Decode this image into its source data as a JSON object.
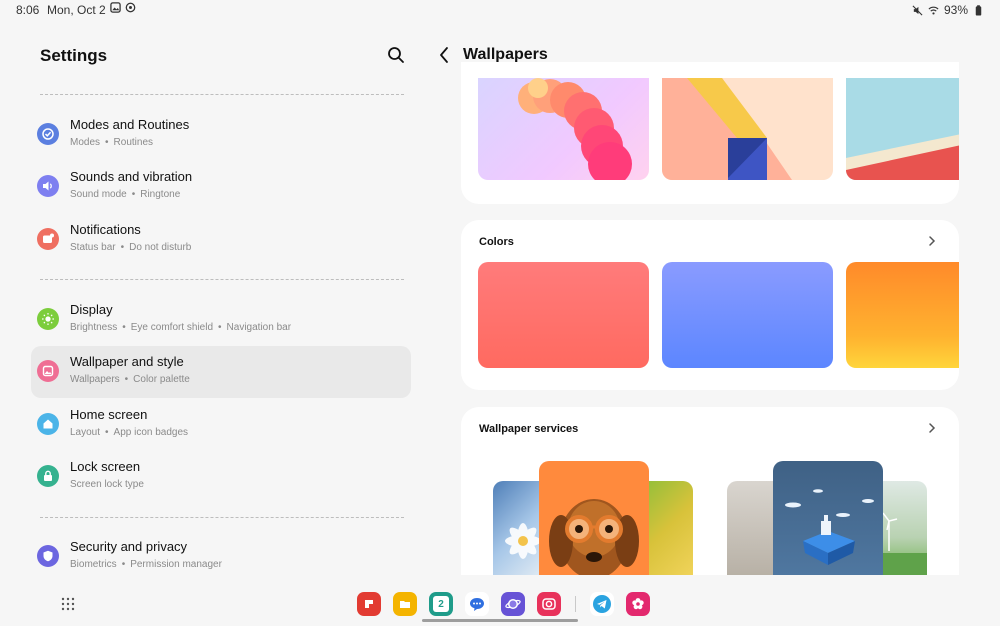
{
  "status": {
    "time": "8:06",
    "date": "Mon, Oct 2",
    "battery": "93%"
  },
  "left": {
    "title": "Settings",
    "items": [
      {
        "title": "Modes and Routines",
        "subs": [
          "Modes",
          "Routines"
        ],
        "color": "#5b7fe0"
      },
      {
        "title": "Sounds and vibration",
        "subs": [
          "Sound mode",
          "Ringtone"
        ],
        "color": "#7e7ff0"
      },
      {
        "title": "Notifications",
        "subs": [
          "Status bar",
          "Do not disturb"
        ],
        "color": "#ef6f61"
      },
      {
        "title": "Display",
        "subs": [
          "Brightness",
          "Eye comfort shield",
          "Navigation bar"
        ],
        "color": "#7ccd3c"
      },
      {
        "title": "Wallpaper and style",
        "subs": [
          "Wallpapers",
          "Color palette"
        ],
        "color": "#ef6e94"
      },
      {
        "title": "Home screen",
        "subs": [
          "Layout",
          "App icon badges"
        ],
        "color": "#4bb4e8"
      },
      {
        "title": "Lock screen",
        "subs": [
          "Screen lock type"
        ],
        "color": "#35b28f"
      },
      {
        "title": "Security and privacy",
        "subs": [
          "Biometrics",
          "Permission manager"
        ],
        "color": "#6c66e0"
      }
    ]
  },
  "right": {
    "title": "Wallpapers",
    "colors_label": "Colors",
    "services_label": "Wallpaper services"
  },
  "dock": {
    "apps": [
      {
        "name": "flipboard",
        "color": "#e23b32"
      },
      {
        "name": "my-files",
        "color": "#f4b400"
      },
      {
        "name": "calendar",
        "color": "#1f9c8a",
        "text": "2"
      },
      {
        "name": "messages",
        "color": "#ffffff"
      },
      {
        "name": "internet",
        "color": "#6753d6"
      },
      {
        "name": "camera",
        "color": "#e8325b"
      },
      {
        "name": "telegram",
        "color": "#ffffff"
      },
      {
        "name": "blossom",
        "color": "#e3296e"
      }
    ]
  }
}
